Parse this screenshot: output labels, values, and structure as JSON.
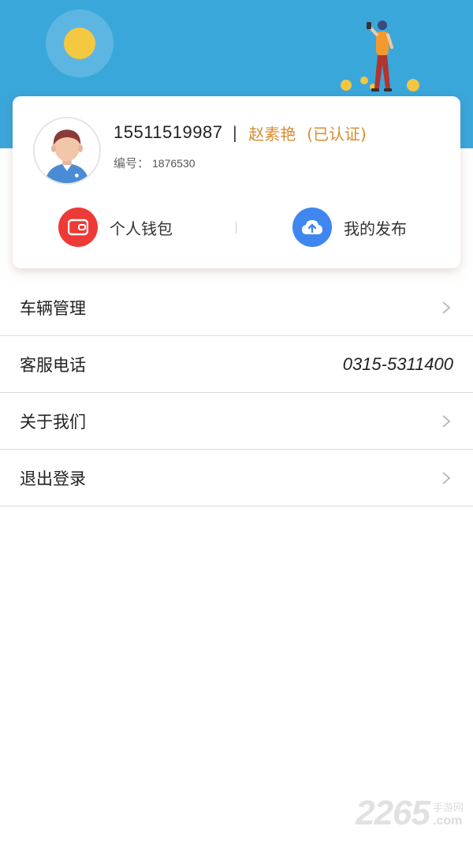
{
  "header": {
    "background_color": "#3aa7db",
    "illustration_icons": [
      "sun-icon",
      "person-with-phone-illustration",
      "coin-icon"
    ]
  },
  "profile": {
    "phone": "15511519987",
    "separator": "|",
    "name": "赵素艳",
    "verified_label": "(已认证)",
    "id_label": "编号：",
    "id_value": "1876530",
    "accent_color": "#d98c2f",
    "avatar_icon": "user-avatar-icon"
  },
  "actions": [
    {
      "label": "个人钱包",
      "icon": "wallet-icon",
      "color": "#ee3a36"
    },
    {
      "label": "我的发布",
      "icon": "cloud-upload-icon",
      "color": "#3f86f1"
    }
  ],
  "menu": [
    {
      "label": "车辆管理",
      "trailing": "chevron-right-icon"
    },
    {
      "label": "客服电话",
      "value": "0315-5311400"
    },
    {
      "label": "关于我们",
      "trailing": "chevron-right-icon"
    },
    {
      "label": "退出登录",
      "trailing": "chevron-right-icon"
    }
  ],
  "watermark": {
    "number": "2265",
    "cn": "手游网",
    "domain": ".com"
  }
}
